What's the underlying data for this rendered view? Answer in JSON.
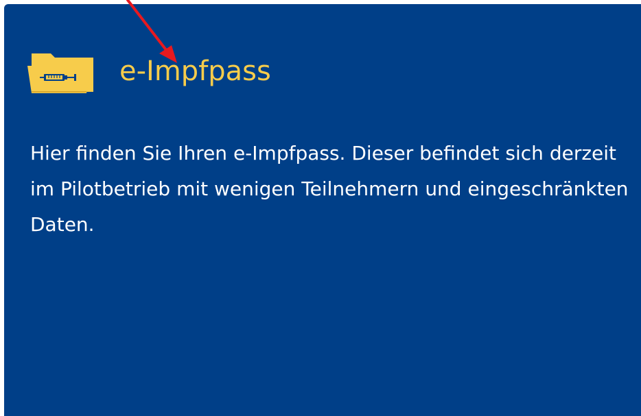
{
  "card": {
    "title": "e-Impfpass",
    "icon": "folder-syringe-icon",
    "description": "Hier finden Sie Ihren e-Impfpass. Dieser befindet sich derzeit im Pilotbetrieb mit wenigen Teilnehmern und eingeschränkten Daten.",
    "colors": {
      "background": "#003f88",
      "title": "#f7cc4b",
      "icon": "#f7cc4b",
      "text": "#ffffff",
      "annotation_arrow": "#e8191f"
    }
  }
}
